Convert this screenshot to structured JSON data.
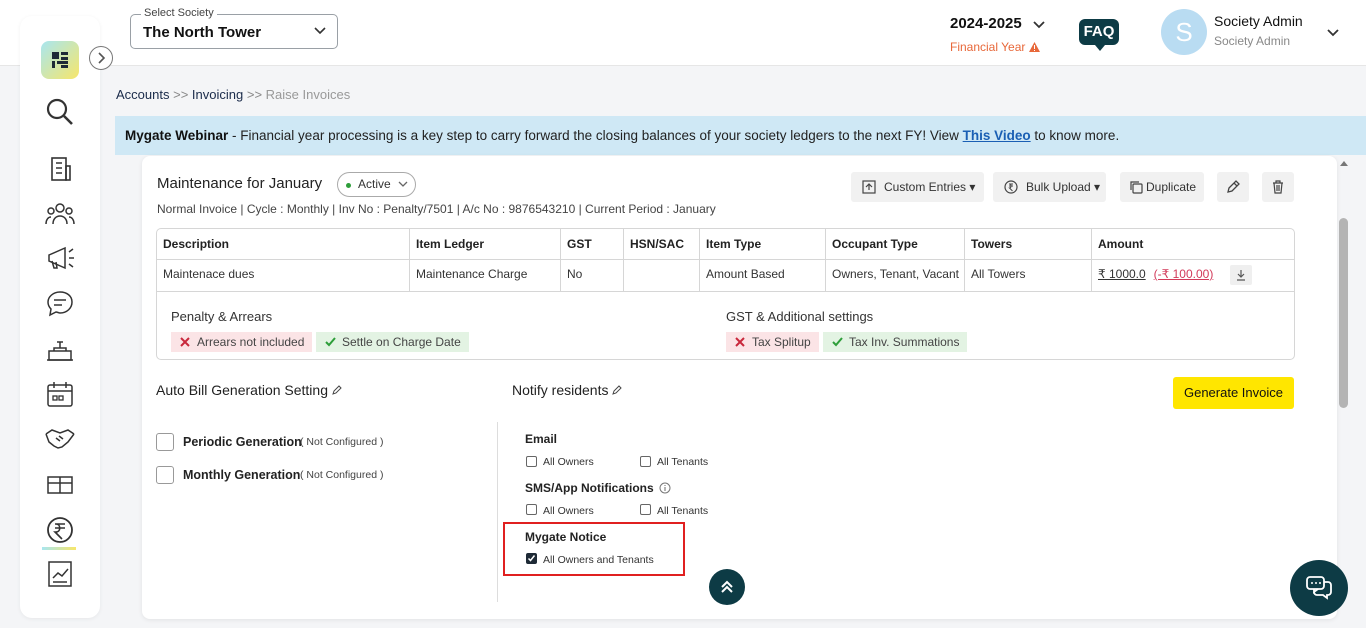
{
  "header": {
    "society_label": "Select Society",
    "society_value": "The North Tower",
    "year": "2024-2025",
    "year_sub": "Financial Year",
    "faq": "FAQ",
    "avatar_letter": "S",
    "user_name": "Society Admin",
    "user_role": "Society Admin"
  },
  "sidebar": {
    "items": [
      "search-icon",
      "building-icon",
      "residents-icon",
      "megaphone-icon",
      "chat-icon",
      "helpdesk-icon",
      "calendar-icon",
      "handshake-icon",
      "amenity-icon",
      "accounts-rupee-icon",
      "reports-icon"
    ],
    "active": "accounts-rupee-icon"
  },
  "breadcrumb": {
    "l1": "Accounts",
    "sep": ">>",
    "l2": "Invoicing",
    "cur": "Raise Invoices"
  },
  "banner": {
    "bold": "Mygate Webinar",
    "text": " - Financial year processing is a key step to carry forward the closing balances of your society ledgers to the next FY! View ",
    "link": "This Video",
    "tail": " to know more."
  },
  "invoice": {
    "title": "Maintenance for January",
    "status": "Active",
    "meta": "Normal Invoice | Cycle : Monthly | Inv No : Penalty/7501 | A/c No : 9876543210 | Current Period : January",
    "buttons": {
      "custom": "Custom Entries",
      "bulk": "Bulk Upload",
      "duplicate": "Duplicate"
    },
    "columns": [
      "Description",
      "Item Ledger",
      "GST",
      "HSN/SAC",
      "Item Type",
      "Occupant Type",
      "Towers",
      "Amount"
    ],
    "row": [
      "Maintenace dues",
      "Maintenance Charge",
      "No",
      "",
      "Amount Based",
      "Owners, Tenant, Vacant",
      "All Towers"
    ],
    "amount": "₹ 1000.0",
    "amount_neg": "(-₹ 100.00)",
    "penalty_title": "Penalty & Arrears",
    "penalty_chips": [
      "Arrears not included",
      "Settle on Charge Date"
    ],
    "gst_title": "GST & Additional settings",
    "gst_chips": [
      "Tax Splitup",
      "Tax Inv. Summations"
    ]
  },
  "settings": {
    "auto_title": "Auto Bill Generation Setting",
    "notify_title": "Notify residents",
    "generate": "Generate Invoice",
    "periodic": "Periodic Generation",
    "monthly": "Monthly Generation",
    "not_configured": "( Not Configured )",
    "email": "Email",
    "sms": "SMS/App Notifications",
    "notice": "Mygate Notice",
    "all_owners": "All Owners",
    "all_tenants": "All Tenants",
    "all_owners_tenants": "All Owners and Tenants",
    "notice_checked": true
  },
  "colors": {
    "accent_yellow": "#ffe600",
    "dark_teal": "#0d3b45",
    "banner_bg": "#cfe8f5",
    "highlight_red": "#e02020"
  }
}
